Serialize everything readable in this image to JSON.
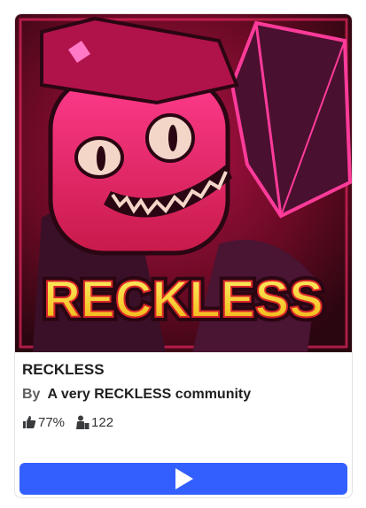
{
  "game": {
    "title": "RECKLESS",
    "thumbnail_text": "RECKLESS",
    "by_label": "By",
    "creator": "A very RECKLESS community",
    "like_ratio": "77%",
    "player_count": "122"
  },
  "icons": {
    "like": "thumbs-up-icon",
    "players": "player-count-icon",
    "play": "play-icon"
  },
  "colors": {
    "play_button": "#335fff",
    "title_text": "#1f1f1f"
  }
}
